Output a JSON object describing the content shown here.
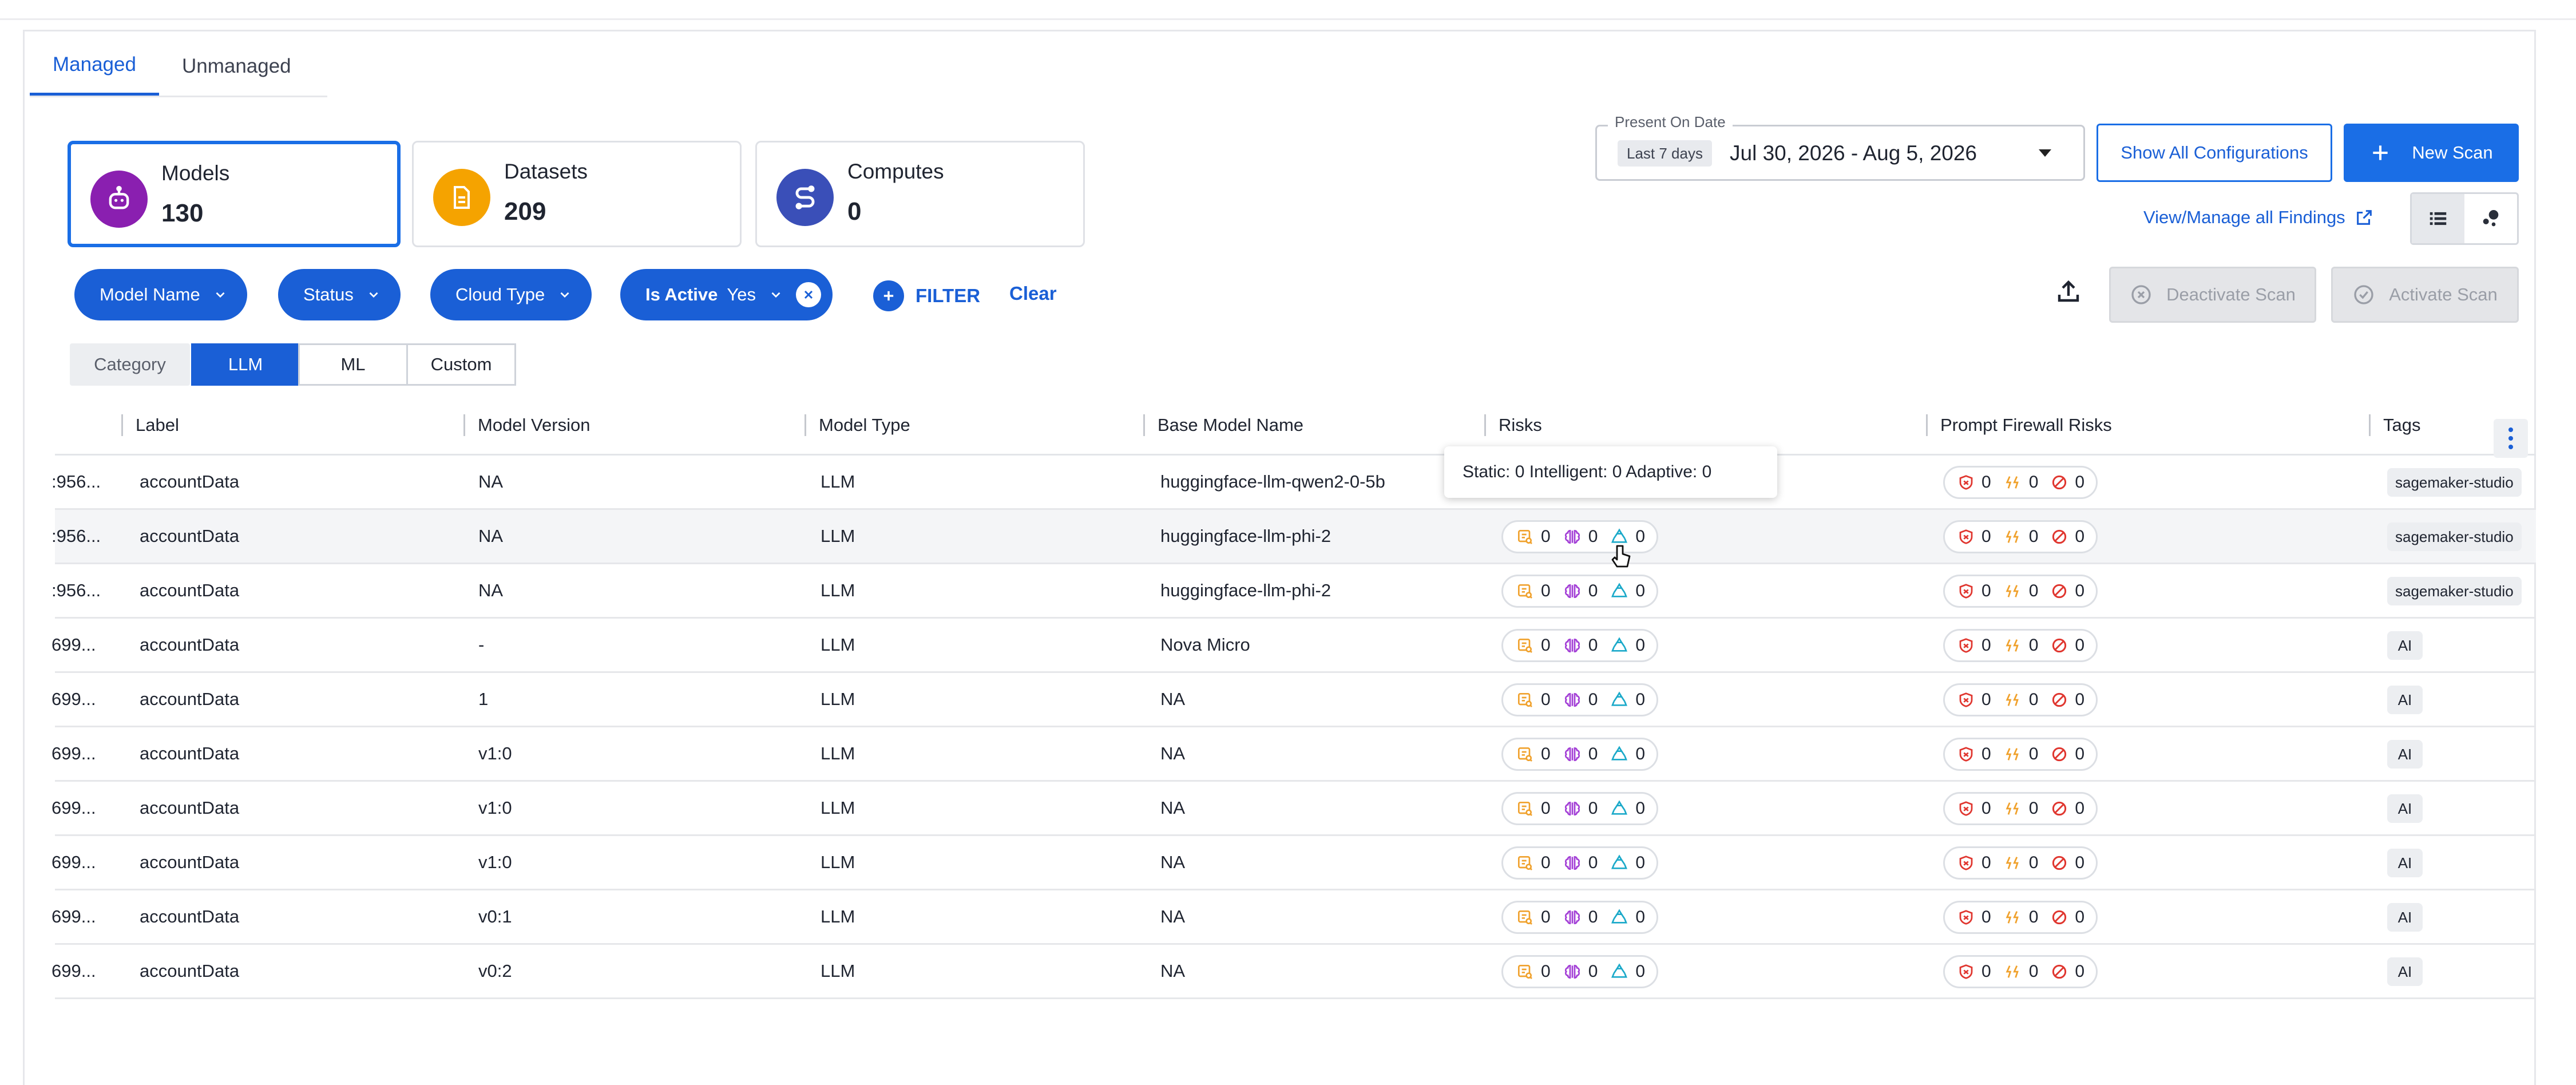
{
  "tabs": [
    {
      "label": "Managed",
      "active": true
    },
    {
      "label": "Unmanaged",
      "active": false
    }
  ],
  "asset_cards": [
    {
      "title": "Models",
      "count": "130",
      "icon": "robot-icon",
      "color": "#8a1fb0",
      "selected": true
    },
    {
      "title": "Datasets",
      "count": "209",
      "icon": "document-icon",
      "color": "#f5a300",
      "selected": false
    },
    {
      "title": "Computes",
      "count": "0",
      "icon": "route-icon",
      "color": "#3a4fb8",
      "selected": false
    }
  ],
  "filters": {
    "chips": [
      {
        "label": "Model Name"
      },
      {
        "label": "Status"
      },
      {
        "label": "Cloud Type"
      },
      {
        "label": "Is Active",
        "value": "Yes",
        "clearable": true
      }
    ],
    "add_label": "FILTER",
    "clear_label": "Clear"
  },
  "category": {
    "label": "Category",
    "options": [
      "LLM",
      "ML",
      "Custom"
    ],
    "selected": "LLM"
  },
  "date_filter": {
    "legend": "Present On Date",
    "preset": "Last 7 days",
    "range": "Jul 30, 2026 - Aug 5, 2026"
  },
  "actions": {
    "show_all": "Show All Configurations",
    "new_scan": "New Scan",
    "findings_link": "View/Manage all Findings",
    "deactivate": "Deactivate Scan",
    "activate": "Activate Scan"
  },
  "table": {
    "columns": [
      "Label",
      "Model Version",
      "Model Type",
      "Base Model Name",
      "Risks",
      "Prompt Firewall Risks",
      "Tags"
    ],
    "rows": [
      {
        "id": ":956...",
        "label": "accountData",
        "version": "NA",
        "type": "LLM",
        "base": "huggingface-llm-qwen2-0-5b",
        "risks": null,
        "fw": [
          "0",
          "0",
          "0"
        ],
        "tag": "sagemaker-studio"
      },
      {
        "id": ":956...",
        "label": "accountData",
        "version": "NA",
        "type": "LLM",
        "base": "huggingface-llm-phi-2",
        "risks": [
          "0",
          "0",
          "0"
        ],
        "fw": [
          "0",
          "0",
          "0"
        ],
        "tag": "sagemaker-studio"
      },
      {
        "id": ":956...",
        "label": "accountData",
        "version": "NA",
        "type": "LLM",
        "base": "huggingface-llm-phi-2",
        "risks": [
          "0",
          "0",
          "0"
        ],
        "fw": [
          "0",
          "0",
          "0"
        ],
        "tag": "sagemaker-studio"
      },
      {
        "id": "699...",
        "label": "accountData",
        "version": "-",
        "type": "LLM",
        "base": "Nova Micro",
        "risks": [
          "0",
          "0",
          "0"
        ],
        "fw": [
          "0",
          "0",
          "0"
        ],
        "tag": "AI"
      },
      {
        "id": "699...",
        "label": "accountData",
        "version": "1",
        "type": "LLM",
        "base": "NA",
        "risks": [
          "0",
          "0",
          "0"
        ],
        "fw": [
          "0",
          "0",
          "0"
        ],
        "tag": "AI"
      },
      {
        "id": "699...",
        "label": "accountData",
        "version": "v1:0",
        "type": "LLM",
        "base": "NA",
        "risks": [
          "0",
          "0",
          "0"
        ],
        "fw": [
          "0",
          "0",
          "0"
        ],
        "tag": "AI"
      },
      {
        "id": "699...",
        "label": "accountData",
        "version": "v1:0",
        "type": "LLM",
        "base": "NA",
        "risks": [
          "0",
          "0",
          "0"
        ],
        "fw": [
          "0",
          "0",
          "0"
        ],
        "tag": "AI"
      },
      {
        "id": "699...",
        "label": "accountData",
        "version": "v1:0",
        "type": "LLM",
        "base": "NA",
        "risks": [
          "0",
          "0",
          "0"
        ],
        "fw": [
          "0",
          "0",
          "0"
        ],
        "tag": "AI"
      },
      {
        "id": "699...",
        "label": "accountData",
        "version": "v0:1",
        "type": "LLM",
        "base": "NA",
        "risks": [
          "0",
          "0",
          "0"
        ],
        "fw": [
          "0",
          "0",
          "0"
        ],
        "tag": "AI"
      },
      {
        "id": "699...",
        "label": "accountData",
        "version": "v0:2",
        "type": "LLM",
        "base": "NA",
        "risks": [
          "0",
          "0",
          "0"
        ],
        "fw": [
          "0",
          "0",
          "0"
        ],
        "tag": "AI"
      }
    ],
    "hover_row": 1
  },
  "tooltip": {
    "text": "Static: 0  Intelligent: 0  Adaptive: 0"
  },
  "colors": {
    "primary": "#1a6ee6",
    "static_risk": "#f0a12c",
    "intelligent_risk": "#a33fd6",
    "adaptive_risk": "#1aa9c9",
    "firewall_shield": "#e0362f",
    "firewall_bolt": "#f0a12c",
    "firewall_block": "#e0362f"
  }
}
